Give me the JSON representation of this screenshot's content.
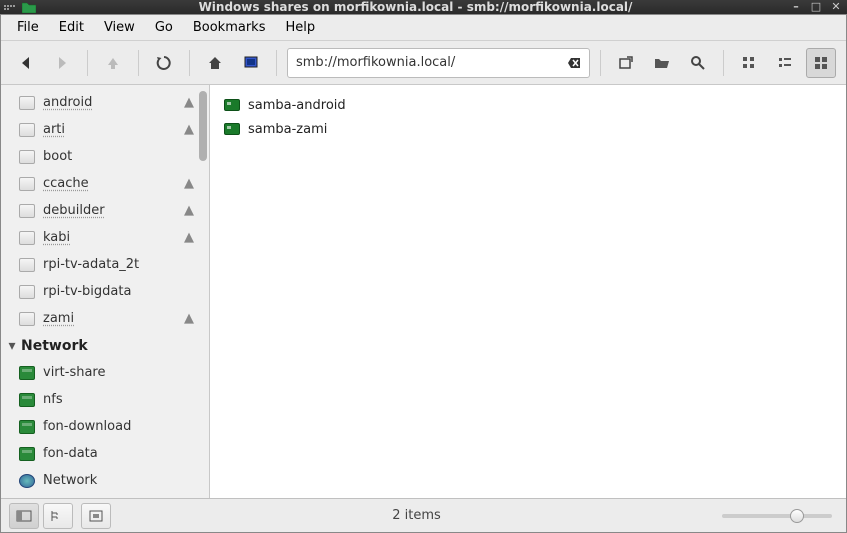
{
  "titlebar": {
    "title": "Windows shares on morfikownia.local - smb://morfikownia.local/"
  },
  "menubar": {
    "items": [
      "File",
      "Edit",
      "View",
      "Go",
      "Bookmarks",
      "Help"
    ]
  },
  "address": {
    "url": "smb://morfikownia.local/"
  },
  "sidebar": {
    "places": [
      {
        "label": "android",
        "eject": true,
        "icon": "drive",
        "underline": true
      },
      {
        "label": "arti",
        "eject": true,
        "icon": "drive",
        "underline": true
      },
      {
        "label": "boot",
        "eject": false,
        "icon": "drive",
        "underline": false
      },
      {
        "label": "ccache",
        "eject": true,
        "icon": "drive",
        "underline": true
      },
      {
        "label": "debuilder",
        "eject": true,
        "icon": "drive",
        "underline": true
      },
      {
        "label": "kabi",
        "eject": true,
        "icon": "drive",
        "underline": true
      },
      {
        "label": "rpi-tv-adata_2t",
        "eject": false,
        "icon": "drive",
        "underline": false
      },
      {
        "label": "rpi-tv-bigdata",
        "eject": false,
        "icon": "drive",
        "underline": false
      },
      {
        "label": "zami",
        "eject": true,
        "icon": "drive",
        "underline": true
      }
    ],
    "network_header": "Network",
    "network": [
      {
        "label": "virt-share",
        "icon": "netfolder"
      },
      {
        "label": "nfs",
        "icon": "netfolder"
      },
      {
        "label": "fon-download",
        "icon": "netfolder"
      },
      {
        "label": "fon-data",
        "icon": "netfolder"
      },
      {
        "label": "Network",
        "icon": "globe"
      }
    ]
  },
  "content": {
    "items": [
      {
        "label": "samba-android"
      },
      {
        "label": "samba-zami"
      }
    ]
  },
  "statusbar": {
    "text": "2 items"
  }
}
